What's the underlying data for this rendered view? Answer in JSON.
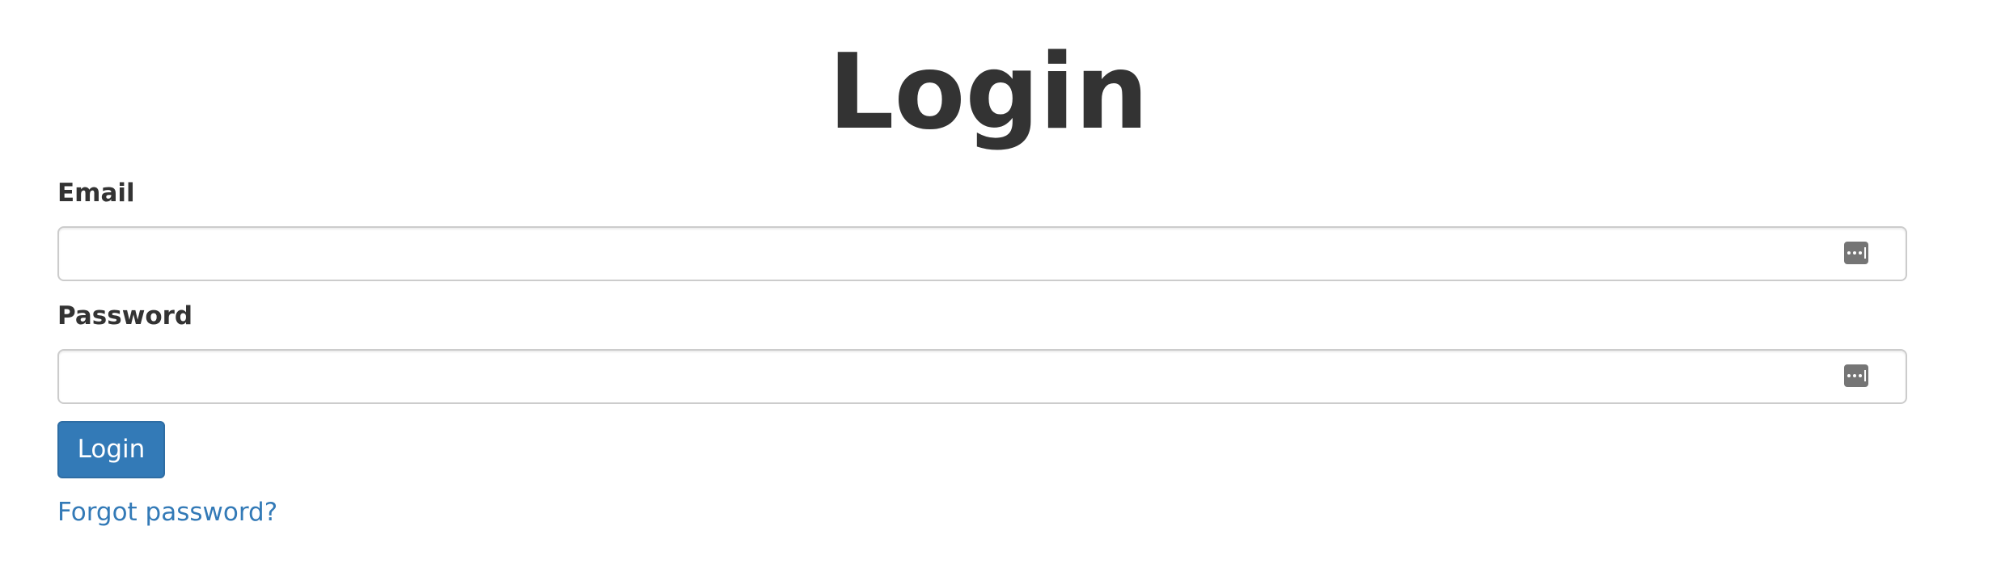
{
  "page": {
    "title": "Login"
  },
  "form": {
    "email_label": "Email",
    "email_value": "",
    "password_label": "Password",
    "password_value": "",
    "submit_label": "Login",
    "forgot_link": "Forgot password?"
  },
  "icons": {
    "field_icon": "password-manager-icon"
  },
  "colors": {
    "primary": "#337ab7",
    "primary_border": "#2e6da4",
    "text": "#333333",
    "input_border": "#cccccc",
    "icon_bg": "#757575"
  }
}
